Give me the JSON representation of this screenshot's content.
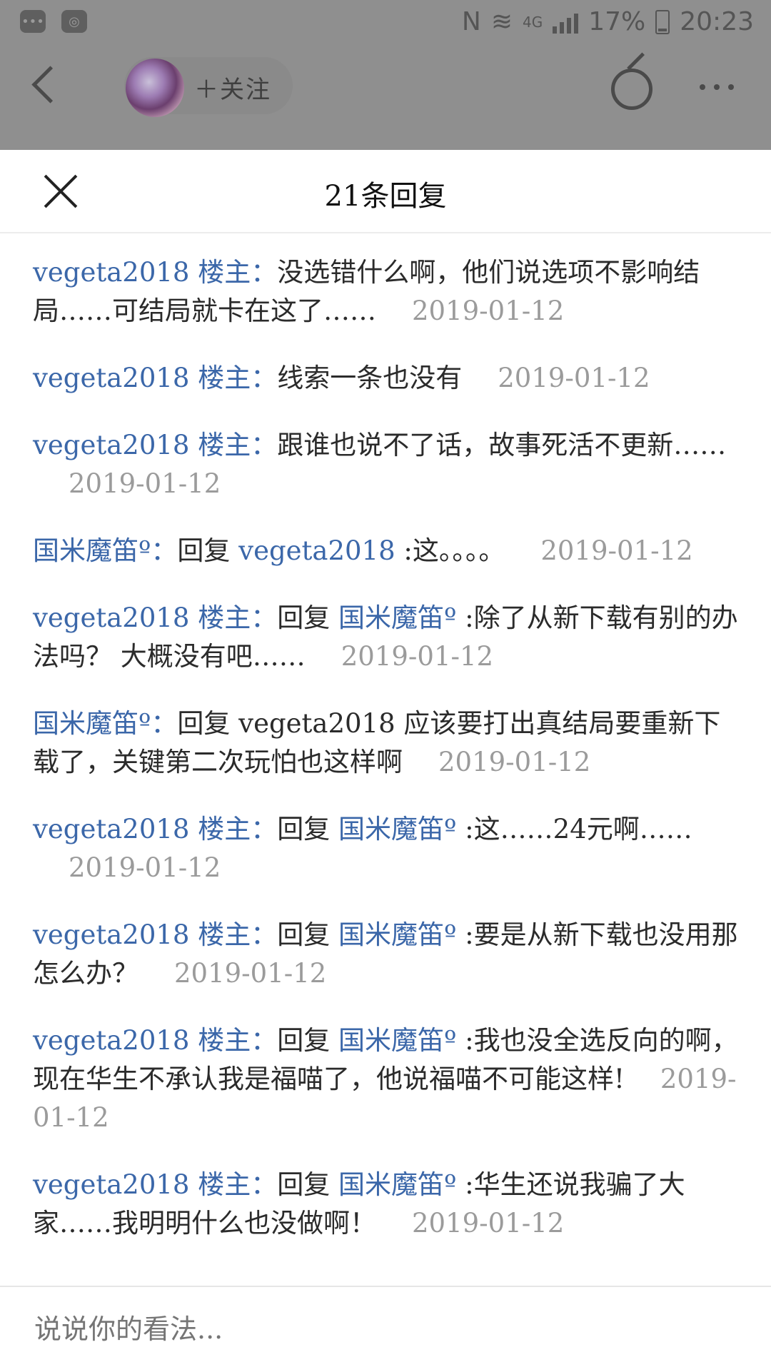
{
  "status": {
    "nfc": "N",
    "network": "4G",
    "battery": "17%",
    "time": "20:23"
  },
  "topbar": {
    "follow_label": "＋关注"
  },
  "sheet": {
    "title": "21条回复",
    "replies": [
      {
        "user": "vegeta2018",
        "tag": "楼主",
        "colon": "：",
        "reply_prefix": "",
        "reply_to": "",
        "text": "没选错什么啊，他们说选项不影响结局……可结局就卡在这了……",
        "date": "2019-01-12"
      },
      {
        "user": "vegeta2018",
        "tag": "楼主",
        "colon": "：",
        "reply_prefix": "",
        "reply_to": "",
        "text": "线索一条也没有",
        "date": "2019-01-12"
      },
      {
        "user": "vegeta2018",
        "tag": "楼主",
        "colon": "：",
        "reply_prefix": "",
        "reply_to": "",
        "text": "跟谁也说不了话，故事死活不更新……",
        "date": "2019-01-12"
      },
      {
        "user": "国米魔笛º",
        "tag": "",
        "colon": "：",
        "reply_prefix": "回复 ",
        "reply_to": "vegeta2018",
        "text": " :这。。。。",
        "date": "2019-01-12"
      },
      {
        "user": "vegeta2018",
        "tag": "楼主",
        "colon": "：",
        "reply_prefix": "回复 ",
        "reply_to": "国米魔笛º",
        "text": " :除了从新下载有别的办法吗？ 大概没有吧……",
        "date": "2019-01-12"
      },
      {
        "user": "国米魔笛º",
        "tag": "",
        "colon": "：",
        "reply_prefix": "回复 vegeta2018 ",
        "reply_to": "",
        "text": "应该要打出真结局要重新下载了，关键第二次玩怕也这样啊",
        "date": "2019-01-12"
      },
      {
        "user": "vegeta2018",
        "tag": "楼主",
        "colon": "：",
        "reply_prefix": "回复 ",
        "reply_to": "国米魔笛º",
        "text": " :这……24元啊……",
        "date": "2019-01-12"
      },
      {
        "user": "vegeta2018",
        "tag": "楼主",
        "colon": "：",
        "reply_prefix": "回复 ",
        "reply_to": "国米魔笛º",
        "text": " :要是从新下载也没用那怎么办？",
        "date": "2019-01-12"
      },
      {
        "user": "vegeta2018",
        "tag": "楼主",
        "colon": "：",
        "reply_prefix": "回复 ",
        "reply_to": "国米魔笛º",
        "text": " :我也没全选反向的啊，现在华生不承认我是福喵了，他说福喵不可能这样!",
        "date": "2019-01-12"
      },
      {
        "user": "vegeta2018",
        "tag": "楼主",
        "colon": "：",
        "reply_prefix": "回复 ",
        "reply_to": "国米魔笛º",
        "text": " :华生还说我骗了大家……我明明什么也没做啊！",
        "date": "2019-01-12"
      }
    ]
  },
  "input": {
    "placeholder": "说说你的看法..."
  }
}
